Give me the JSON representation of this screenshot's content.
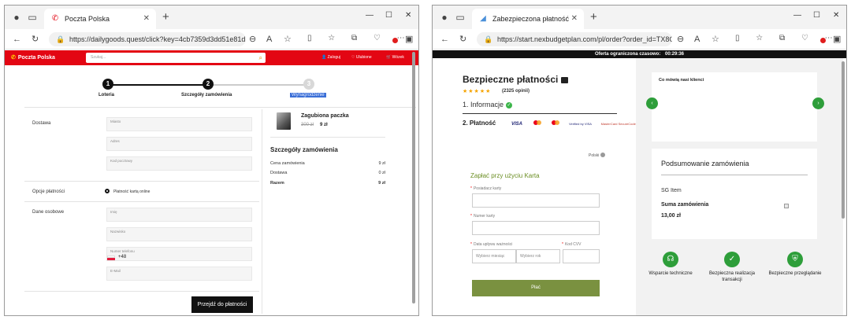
{
  "w1": {
    "tab_title": "Poczta Polska",
    "url": "https://dailygoods.quest/click?key=4cb7359d3dd51e81d1...",
    "site": {
      "logo_text": "Poczta Polska",
      "search_placeholder": "Szukaj...",
      "login": "Zaloguj",
      "favourites": "Ulubione",
      "cart": "Wózek"
    },
    "steps": [
      {
        "num": "1",
        "label": "Loteria"
      },
      {
        "num": "2",
        "label": "Szczegóły zamówienia"
      },
      {
        "num": "3",
        "label": "Wynagrodzenie"
      }
    ],
    "form": {
      "delivery_label": "Dostawa",
      "city": "Miasto",
      "address": "Adres",
      "postal": "Kod pocztowy",
      "payment_label": "Opcje płatności",
      "payment_option": "Płatność kartą online",
      "personal_label": "Dane osobowe",
      "name": "Imię",
      "surname": "Nazwisko",
      "phone": "Numer telefonu",
      "phone_prefix": "+48",
      "email": "E-Mail"
    },
    "checkout_button": "Przejdź do płatności",
    "product": {
      "name": "Zagubiona paczka",
      "old_price": "300 zł",
      "new_price": "9 zł"
    },
    "summary": {
      "title": "Szczegóły zamówienia",
      "rows": [
        {
          "label": "Cena zamówienia",
          "value": "9 zł"
        },
        {
          "label": "Dostawa",
          "value": "0 zł"
        },
        {
          "label": "Razem",
          "value": "9 zł"
        }
      ]
    }
  },
  "w2": {
    "tab_title": "Zabezpieczona płatność",
    "url": "https://start.nexbudgetplan.com/pl/order?order_id=TX8O4...",
    "offer_text": "Oferta ograniczona czasowo:",
    "timer": "00:29:36",
    "title": "Bezpieczne płatności",
    "stars": "★★★★★",
    "reviews": "(2325 opinii)",
    "step1": "1. Informacje",
    "step2": "2. Płatność",
    "visa": "VISA",
    "verified_by_visa": "Verified by VISA",
    "mc_securecode": "MasterCard SecureCode",
    "lang": "Polski",
    "pay_heading": "Zapłać przy użyciu Karta",
    "card_holder": "Posiadacz karty",
    "card_number": "Numer karty",
    "expiry": "Data upływu ważności",
    "cvv": "Kod CVV",
    "month": "Wybierz miesiąc",
    "year": "Wybierz rok",
    "pay_button": "Płać",
    "testimonials_title": "Co mówią nasi klienci",
    "summary_title": "Podsumowanie zamówienia",
    "item": "SG Item",
    "total_label": "Suma zamówienia",
    "total_value": "13,00 zł",
    "badges": [
      {
        "label": "Wsparcie techniczne"
      },
      {
        "label": "Bezpieczna realizacja transakcji"
      },
      {
        "label": "Bezpieczne przeglądanie"
      }
    ]
  }
}
